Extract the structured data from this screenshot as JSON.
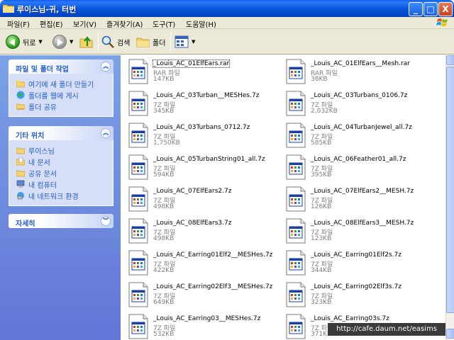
{
  "window": {
    "title": "루이스님-귀, 터번",
    "controls": [
      "_",
      "□",
      "X"
    ]
  },
  "menu": [
    "파일(F)",
    "편집(E)",
    "보기(V)",
    "즐겨찾기(A)",
    "도구(T)",
    "도움말(H)"
  ],
  "toolbar": {
    "back_label": "뒤로",
    "search_label": "검색",
    "folders_label": "폴더"
  },
  "panels": [
    {
      "title": "파일 및 폴더 작업",
      "items": [
        {
          "label": "여기에 새 폴더 만들기",
          "icon": "new-folder-icon"
        },
        {
          "label": "폴더를 웹에 게시",
          "icon": "globe-icon"
        },
        {
          "label": "폴더 공유",
          "icon": "share-folder-icon"
        }
      ]
    },
    {
      "title": "기타 위치",
      "items": [
        {
          "label": "루이스님",
          "icon": "folder-icon"
        },
        {
          "label": "내 문서",
          "icon": "documents-icon"
        },
        {
          "label": "공유 문서",
          "icon": "folder-icon"
        },
        {
          "label": "내 컴퓨터",
          "icon": "computer-icon"
        },
        {
          "label": "내 네트워크 환경",
          "icon": "network-icon"
        }
      ]
    },
    {
      "title": "자세히",
      "items": []
    }
  ],
  "files": [
    {
      "name": "_Louis_AC_01ElfEars.rar",
      "type": "RAR 파일",
      "size": "147KB",
      "selected": true
    },
    {
      "name": "_Louis_AC_01ElfEars__Mesh.rar",
      "type": "RAR 파일",
      "size": "38KB"
    },
    {
      "name": "_Louis_AC_03Turban__MESHes.7z",
      "type": "7Z 파일",
      "size": "345KB"
    },
    {
      "name": "_Louis_AC_03Turbans_0106.7z",
      "type": "7Z 파일",
      "size": "2,032KB"
    },
    {
      "name": "_Louis_AC_03Turbans_0712.7z",
      "type": "7Z 파일",
      "size": "1,750KB"
    },
    {
      "name": "_Louis_AC_04TurbanJewel_all.7z",
      "type": "7Z 파일",
      "size": "585KB"
    },
    {
      "name": "_Louis_AC_05TurbanString01_all.7z",
      "type": "7Z 파일",
      "size": "594KB"
    },
    {
      "name": "_Louis_AC_06Feather01_all.7z",
      "type": "7Z 파일",
      "size": "395KB"
    },
    {
      "name": "_Louis_AC_07ElfEars2.7z",
      "type": "7Z 파일",
      "size": "498KB"
    },
    {
      "name": "_Louis_AC_07ElfEars2__MESH.7z",
      "type": "7Z 파일",
      "size": "126KB"
    },
    {
      "name": "_Louis_AC_08ElfEars3.7z",
      "type": "7Z 파일",
      "size": "498KB"
    },
    {
      "name": "_Louis_AC_08ElfEars3__MESH.7z",
      "type": "7Z 파일",
      "size": "123KB"
    },
    {
      "name": "_Louis_AC_Earring01Elf2__MESHes.7z",
      "type": "7Z 파일",
      "size": "422KB"
    },
    {
      "name": "_Louis_AC_Earring01Elf2s.7z",
      "type": "7Z 파일",
      "size": "344KB"
    },
    {
      "name": "_Louis_AC_Earring02Elf3__MESHes.7z",
      "type": "7Z 파일",
      "size": "649KB"
    },
    {
      "name": "_Louis_AC_Earring02Elf3s.7z",
      "type": "7Z 파일",
      "size": "323KB"
    },
    {
      "name": "_Louis_AC_Earring03__MESHes.7z",
      "type": "7Z 파일",
      "size": "532KB"
    },
    {
      "name": "_Louis_AC_Earring03s.7z",
      "type": "7Z 파일",
      "size": "371KB"
    }
  ],
  "watermark": "http://cafe.daum.net/easims"
}
